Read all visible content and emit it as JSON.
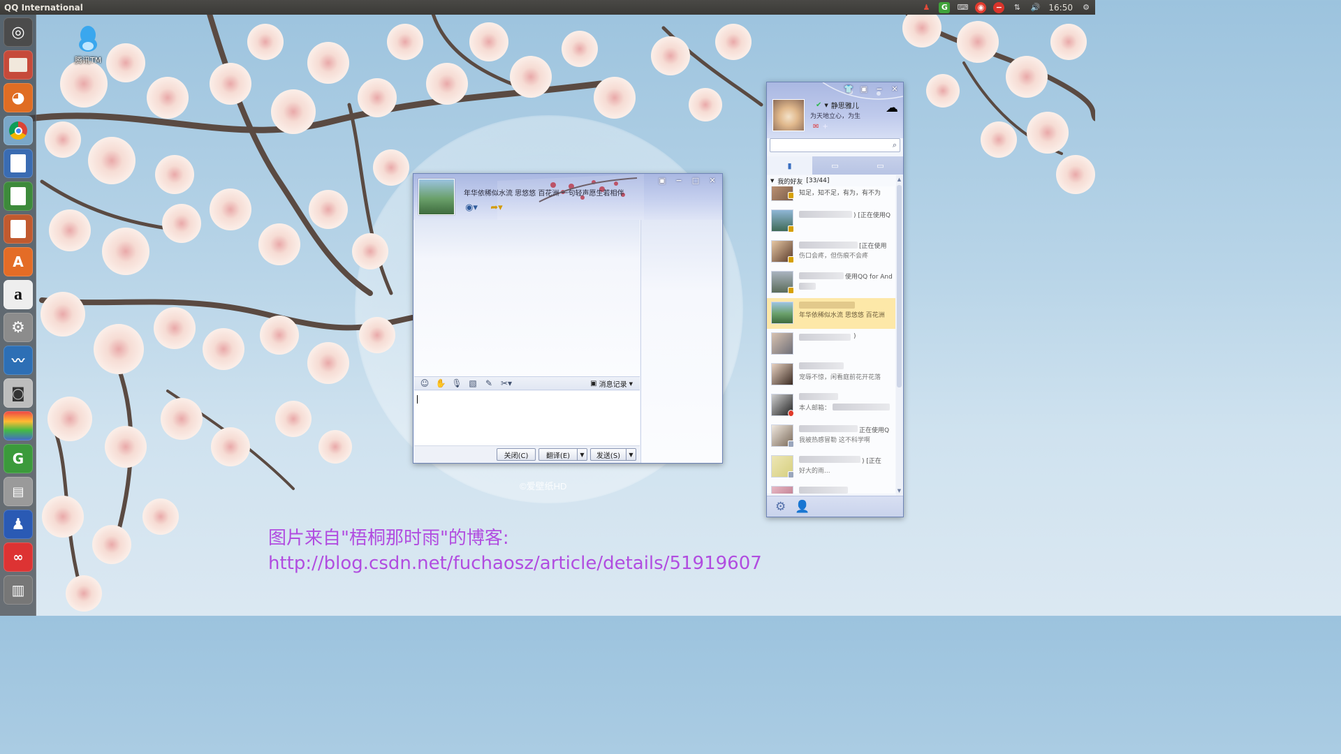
{
  "topbar": {
    "app_title": "QQ International",
    "clock": "16:50",
    "tray_icons": [
      "qq-tray-icon",
      "green-g-icon",
      "keyboard-icon",
      "weibo-icon",
      "stop-icon",
      "network-icon",
      "volume-icon",
      "gear-icon"
    ]
  },
  "launcher": {
    "items": [
      "ubuntu-dash-icon",
      "files-icon",
      "firefox-icon",
      "chrome-icon",
      "writer-icon",
      "calc-icon",
      "impress-icon",
      "software-center-icon",
      "amazon-icon",
      "system-settings-icon",
      "system-monitor-icon",
      "camera-icon",
      "color-tool-icon",
      "green-app-icon",
      "scanner-icon",
      "qq-penguin-icon",
      "red-app-icon",
      "trash-icon"
    ]
  },
  "desktop": {
    "icon_label": "腾讯TM",
    "wallpaper_watermark": "©爱壁纸HD"
  },
  "chat_window": {
    "signature": "年华依稀似水流 思悠悠 百花洲 一句轻声愿生若相伴",
    "history_label": "消息记录",
    "close_button": "关闭(C)",
    "translate_button": "翻译(E)",
    "send_button": "发送(S)"
  },
  "buddy_window": {
    "nickname": "静思雅儿",
    "signature": "为天地立心，为生",
    "group_name": "我的好友",
    "group_count": "[33/44]",
    "buddies": [
      {
        "line1": "知足，知不足，有为，有不为",
        "line2": "",
        "selected": false
      },
      {
        "line1": ") [正在使用Q",
        "line2": "",
        "selected": false
      },
      {
        "line1": "[正在使用",
        "line2": "伤口会疼，但伤痕不会疼",
        "selected": false
      },
      {
        "line1": "使用QQ for And",
        "line2": "",
        "selected": false
      },
      {
        "line1": "",
        "line2": "年华依稀似水流 思悠悠 百花洲",
        "selected": true
      },
      {
        "line1": ")",
        "line2": "",
        "selected": false
      },
      {
        "line1": "",
        "line2": "宠辱不惊，闲看庭前花开花落",
        "selected": false
      },
      {
        "line1": "",
        "line2": "本人邮箱：",
        "selected": false
      },
      {
        "line1": "正在使用Q",
        "line2": "我被热感冒勒 这不科学啊",
        "selected": false
      },
      {
        "line1": ") [正在",
        "line2": "好大的雨...",
        "selected": false
      },
      {
        "line1": "",
        "line2": "",
        "selected": false
      }
    ]
  },
  "caption": {
    "line1": "图片来自\"梧桐那时雨\"的博客:",
    "line2": "http://blog.csdn.net/fuchaosz/article/details/51919607"
  },
  "colors": {
    "caption": "#b14de0",
    "window_border": "#6e84b6",
    "selected_buddy": "#fde8a8"
  }
}
